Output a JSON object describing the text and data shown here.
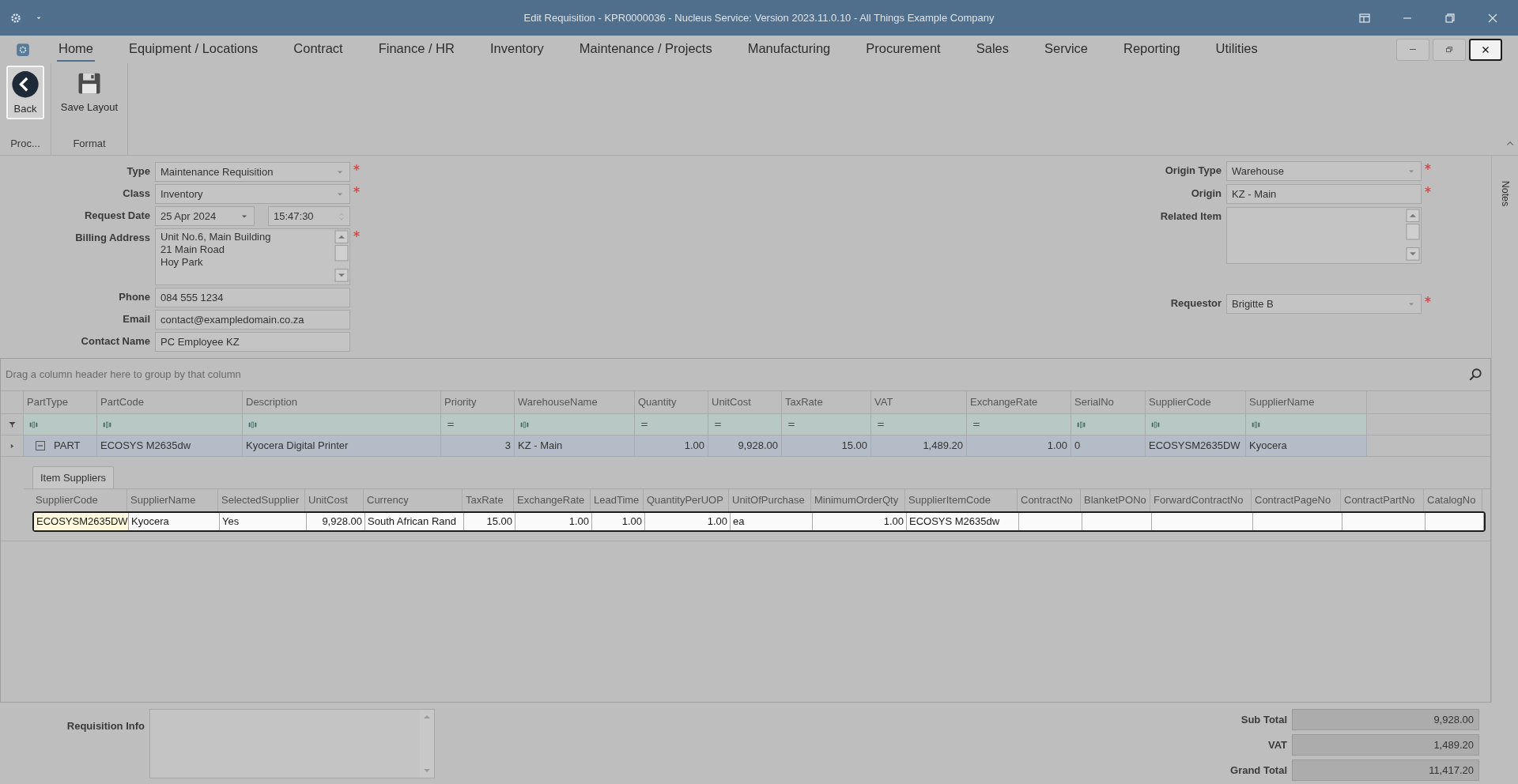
{
  "window": {
    "title": "Edit Requisition - KPR0000036 - Nucleus Service: Version 2023.11.0.10 - All Things Example Company"
  },
  "menu_tabs": [
    {
      "label": "Home",
      "selected": true
    },
    {
      "label": "Equipment / Locations",
      "selected": false
    },
    {
      "label": "Contract",
      "selected": false
    },
    {
      "label": "Finance / HR",
      "selected": false
    },
    {
      "label": "Inventory",
      "selected": false
    },
    {
      "label": "Maintenance / Projects",
      "selected": false
    },
    {
      "label": "Manufacturing",
      "selected": false
    },
    {
      "label": "Procurement",
      "selected": false
    },
    {
      "label": "Sales",
      "selected": false
    },
    {
      "label": "Service",
      "selected": false
    },
    {
      "label": "Reporting",
      "selected": false
    },
    {
      "label": "Utilities",
      "selected": false
    }
  ],
  "ribbon": [
    {
      "label": "Proc...",
      "buttons": [
        {
          "kind": "back",
          "label": "Back"
        }
      ]
    },
    {
      "label": "Format",
      "buttons": [
        {
          "kind": "save",
          "label": "Save Layout"
        }
      ]
    }
  ],
  "form_left": [
    {
      "kind": "dropdown",
      "label": "Type",
      "value": "Maintenance Requisition",
      "required": true
    },
    {
      "kind": "dropdown",
      "label": "Class",
      "value": "Inventory",
      "required": true
    },
    {
      "kind": "datetime",
      "label": "Request Date",
      "value": "25 Apr 2024",
      "time": "15:47:30",
      "required": false
    },
    {
      "kind": "memo",
      "label": "Billing Address",
      "value": "Unit No.6, Main Building\n21 Main Road\nHoy Park",
      "required": true
    },
    {
      "kind": "text",
      "label": "Phone",
      "value": "084 555 1234",
      "required": false
    },
    {
      "kind": "text",
      "label": "Email",
      "value": "contact@exampledomain.co.za",
      "required": false
    },
    {
      "kind": "text",
      "label": "Contact Name",
      "value": "PC Employee KZ",
      "required": false
    }
  ],
  "form_right": [
    {
      "kind": "dropdown",
      "label": "Origin Type",
      "value": "Warehouse",
      "required": true
    },
    {
      "kind": "text",
      "label": "Origin",
      "value": "KZ - Main",
      "required": true
    },
    {
      "kind": "memo",
      "label": "Related Item",
      "required": false
    },
    {
      "kind": "dropdown",
      "label": "Requestor",
      "value": "Brigitte B",
      "required": true
    }
  ],
  "notes_tab": "Notes",
  "grid": {
    "group_panel": "Drag a column header here to group by that column",
    "columns": [
      {
        "label": "PartType",
        "kind": "text"
      },
      {
        "label": "PartCode",
        "kind": "text"
      },
      {
        "label": "Description",
        "kind": "text"
      },
      {
        "label": "Priority",
        "kind": "number"
      },
      {
        "label": "WarehouseName",
        "kind": "text"
      },
      {
        "label": "Quantity",
        "kind": "number"
      },
      {
        "label": "UnitCost",
        "kind": "number"
      },
      {
        "label": "TaxRate",
        "kind": "number"
      },
      {
        "label": "VAT",
        "kind": "number"
      },
      {
        "label": "ExchangeRate",
        "kind": "number"
      },
      {
        "label": "SerialNo",
        "kind": "text"
      },
      {
        "label": "SupplierCode",
        "kind": "text"
      },
      {
        "label": "SupplierName",
        "kind": "text"
      }
    ],
    "rows": [
      {
        "expanded": true,
        "cells": [
          "PART",
          "ECOSYS M2635dw",
          "Kyocera Digital Printer",
          "3",
          "KZ - Main",
          "1.00",
          "9,928.00",
          "15.00",
          "1,489.20",
          "1.00",
          "0",
          "ECOSYSM2635DW",
          "Kyocera"
        ]
      }
    ],
    "detail": {
      "tab": "Item Suppliers",
      "columns": [
        {
          "label": "SupplierCode",
          "kind": "text"
        },
        {
          "label": "SupplierName",
          "kind": "text"
        },
        {
          "label": "SelectedSupplier",
          "kind": "text"
        },
        {
          "label": "UnitCost",
          "kind": "number"
        },
        {
          "label": "Currency",
          "kind": "text"
        },
        {
          "label": "TaxRate",
          "kind": "number"
        },
        {
          "label": "ExchangeRate",
          "kind": "number"
        },
        {
          "label": "LeadTime",
          "kind": "number"
        },
        {
          "label": "QuantityPerUOP",
          "kind": "number"
        },
        {
          "label": "UnitOfPurchase",
          "kind": "text"
        },
        {
          "label": "MinimumOrderQty",
          "kind": "number"
        },
        {
          "label": "SupplierItemCode",
          "kind": "text"
        },
        {
          "label": "ContractNo",
          "kind": "text"
        },
        {
          "label": "BlanketPONo",
          "kind": "text"
        },
        {
          "label": "ForwardContractNo",
          "kind": "text"
        },
        {
          "label": "ContractPageNo",
          "kind": "text"
        },
        {
          "label": "ContractPartNo",
          "kind": "text"
        },
        {
          "label": "CatalogNo",
          "kind": "text"
        }
      ],
      "rows": [
        {
          "selected": true,
          "cells": [
            "ECOSYSM2635DW",
            "Kyocera",
            "Yes",
            "9,928.00",
            "South African Rand",
            "15.00",
            "1.00",
            "1.00",
            "1.00",
            "ea",
            "1.00",
            "ECOSYS M2635dw",
            "",
            "",
            "",
            "",
            "",
            ""
          ]
        }
      ]
    }
  },
  "requisition_info": {
    "label": "Requisition Info"
  },
  "totals": [
    {
      "label": "Sub Total",
      "value": "9,928.00"
    },
    {
      "label": "VAT",
      "value": "1,489.20"
    },
    {
      "label": "Grand Total",
      "value": "11,417.20"
    }
  ]
}
